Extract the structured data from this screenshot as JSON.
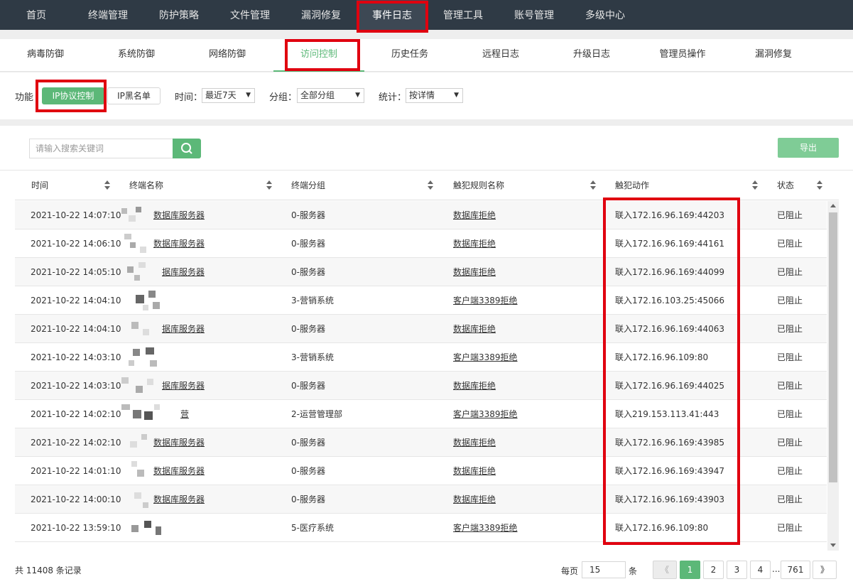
{
  "topnav": [
    "首页",
    "终端管理",
    "防护策略",
    "文件管理",
    "漏洞修复",
    "事件日志",
    "管理工具",
    "账号管理",
    "多级中心"
  ],
  "subtabs": [
    "病毒防御",
    "系统防御",
    "网络防御",
    "访问控制",
    "历史任务",
    "远程日志",
    "升级日志",
    "管理员操作",
    "漏洞修复"
  ],
  "filters": {
    "function_label": "功能",
    "ip_protocol": "IP协议控制",
    "ip_blacklist": "IP黑名单",
    "time_label": "时间：",
    "time_value": "最近7天",
    "group_label": "分组：",
    "group_value": "全部分组",
    "stats_label": "统计：",
    "stats_value": "按详情"
  },
  "toolbar": {
    "search_placeholder": "请输入搜索关键词",
    "export_label": "导出"
  },
  "table": {
    "headers": [
      "时间",
      "终端名称",
      "终端分组",
      "触犯规则名称",
      "触犯动作",
      "状态"
    ],
    "rows": [
      [
        "2021-10-22 14:07:10",
        "数据库服务器",
        "0-服务器",
        "数据库拒绝",
        "联入172.16.96.169:44203",
        "已阻止"
      ],
      [
        "2021-10-22 14:06:10",
        "数据库服务器",
        "0-服务器",
        "数据库拒绝",
        "联入172.16.96.169:44161",
        "已阻止"
      ],
      [
        "2021-10-22 14:05:10",
        "据库服务器",
        "0-服务器",
        "数据库拒绝",
        "联入172.16.96.169:44099",
        "已阻止"
      ],
      [
        "2021-10-22 14:04:10",
        "",
        "3-营销系统",
        "客户端3389拒绝",
        "联入172.16.103.25:45066",
        "已阻止"
      ],
      [
        "2021-10-22 14:04:10",
        "据库服务器",
        "0-服务器",
        "数据库拒绝",
        "联入172.16.96.169:44063",
        "已阻止"
      ],
      [
        "2021-10-22 14:03:10",
        "",
        "3-营销系统",
        "客户端3389拒绝",
        "联入172.16.96.109:80",
        "已阻止"
      ],
      [
        "2021-10-22 14:03:10",
        "据库服务器",
        "0-服务器",
        "数据库拒绝",
        "联入172.16.96.169:44025",
        "已阻止"
      ],
      [
        "2021-10-22 14:02:10",
        "营",
        "2-运营管理部",
        "客户端3389拒绝",
        "联入219.153.113.41:443",
        "已阻止"
      ],
      [
        "2021-10-22 14:02:10",
        "数据库服务器",
        "0-服务器",
        "数据库拒绝",
        "联入172.16.96.169:43985",
        "已阻止"
      ],
      [
        "2021-10-22 14:01:10",
        "数据库服务器",
        "0-服务器",
        "数据库拒绝",
        "联入172.16.96.169:43947",
        "已阻止"
      ],
      [
        "2021-10-22 14:00:10",
        "数据库服务器",
        "0-服务器",
        "数据库拒绝",
        "联入172.16.96.169:43903",
        "已阻止"
      ],
      [
        "2021-10-22 13:59:10",
        "",
        "5-医疗系统",
        "客户端3389拒绝",
        "联入172.16.96.109:80",
        "已阻止"
      ]
    ]
  },
  "footer": {
    "total": "共 11408 条记录",
    "per_page_label": "每页",
    "per_page_value": "15",
    "per_page_unit": "条",
    "prev": "《",
    "pages": [
      "1",
      "2",
      "3",
      "4"
    ],
    "dots": "...",
    "last_page": "761",
    "next": "》"
  },
  "colors": {
    "nav_bg": "#2f3a45",
    "accent_green": "#5cb878",
    "annotation_red": "#e0000f"
  }
}
